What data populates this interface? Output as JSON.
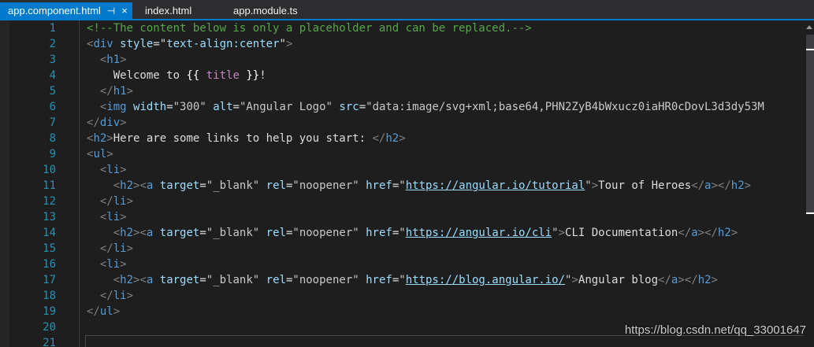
{
  "tabs": [
    {
      "label": "app.component.html",
      "active": true,
      "pin_icon": "pin-icon",
      "close_icon": "close-icon"
    },
    {
      "label": "index.html",
      "active": false
    },
    {
      "label": "app.module.ts",
      "active": false
    }
  ],
  "editor": {
    "line_numbers": [
      "1",
      "2",
      "3",
      "4",
      "5",
      "6",
      "7",
      "8",
      "9",
      "10",
      "11",
      "12",
      "13",
      "14",
      "15",
      "16",
      "17",
      "18",
      "19",
      "20",
      "21"
    ],
    "lines": {
      "l1": {
        "comment": "<!--The content below is only a placeholder and can be replaced.-->"
      },
      "l2": {
        "open": "<",
        "tag": "div",
        "sp": " ",
        "attr": "style",
        "eq": "=",
        "q1": "\"",
        "val": "text-align:center",
        "q2": "\"",
        "close": ">"
      },
      "l3": {
        "indent": "  ",
        "open": "<",
        "tag": "h1",
        "close": ">"
      },
      "l4": {
        "indent": "    ",
        "text1": "Welcome to ",
        "brace1": "{{",
        "sp1": " ",
        "binding": "title",
        "sp2": " ",
        "brace2": "}}",
        "text2": "!"
      },
      "l5": {
        "indent": "  ",
        "open": "</",
        "tag": "h1",
        "close": ">"
      },
      "l6": {
        "indent": "  ",
        "open": "<",
        "tag": "img",
        "sp1": " ",
        "attr1": "width",
        "eq1": "=",
        "v1": "\"300\"",
        "sp2": " ",
        "attr2": "alt",
        "eq2": "=",
        "v2": "\"Angular Logo\"",
        "sp3": " ",
        "attr3": "src",
        "eq3": "=",
        "v3": "\"data:image/svg+xml;base64,PHN2ZyB4bWxucz0iaHR0cDovL3d3dy53M"
      },
      "l7": {
        "open": "</",
        "tag": "div",
        "close": ">"
      },
      "l8": {
        "open": "<",
        "tag": "h2",
        "close": ">",
        "text": "Here are some links to help you start: ",
        "open2": "</",
        "tag2": "h2",
        "close2": ">"
      },
      "l9": {
        "open": "<",
        "tag": "ul",
        "close": ">"
      },
      "l10": {
        "indent": "  ",
        "open": "<",
        "tag": "li",
        "close": ">"
      },
      "l11": {
        "indent": "    ",
        "open1": "<",
        "tag1": "h2",
        "close1": ">",
        "open2": "<",
        "tag2": "a",
        "sp1": " ",
        "attr1": "target",
        "eq1": "=",
        "v1": "\"_blank\"",
        "sp2": " ",
        "attr2": "rel",
        "eq2": "=",
        "v2": "\"noopener\"",
        "sp3": " ",
        "attr3": "href",
        "eq3": "=",
        "q1": "\"",
        "url": "https://angular.io/tutorial",
        "q2": "\"",
        "close2": ">",
        "text": "Tour of Heroes",
        "open3": "</",
        "tag3": "a",
        "close3": ">",
        "open4": "</",
        "tag4": "h2",
        "close4": ">"
      },
      "l12": {
        "indent": "  ",
        "open": "</",
        "tag": "li",
        "close": ">"
      },
      "l13": {
        "indent": "  ",
        "open": "<",
        "tag": "li",
        "close": ">"
      },
      "l14": {
        "indent": "    ",
        "open1": "<",
        "tag1": "h2",
        "close1": ">",
        "open2": "<",
        "tag2": "a",
        "sp1": " ",
        "attr1": "target",
        "eq1": "=",
        "v1": "\"_blank\"",
        "sp2": " ",
        "attr2": "rel",
        "eq2": "=",
        "v2": "\"noopener\"",
        "sp3": " ",
        "attr3": "href",
        "eq3": "=",
        "q1": "\"",
        "url": "https://angular.io/cli",
        "q2": "\"",
        "close2": ">",
        "text": "CLI Documentation",
        "open3": "</",
        "tag3": "a",
        "close3": ">",
        "open4": "</",
        "tag4": "h2",
        "close4": ">"
      },
      "l15": {
        "indent": "  ",
        "open": "</",
        "tag": "li",
        "close": ">"
      },
      "l16": {
        "indent": "  ",
        "open": "<",
        "tag": "li",
        "close": ">"
      },
      "l17": {
        "indent": "    ",
        "open1": "<",
        "tag1": "h2",
        "close1": ">",
        "open2": "<",
        "tag2": "a",
        "sp1": " ",
        "attr1": "target",
        "eq1": "=",
        "v1": "\"_blank\"",
        "sp2": " ",
        "attr2": "rel",
        "eq2": "=",
        "v2": "\"noopener\"",
        "sp3": " ",
        "attr3": "href",
        "eq3": "=",
        "q1": "\"",
        "url": "https://blog.angular.io/",
        "q2": "\"",
        "close2": ">",
        "text": "Angular blog",
        "open3": "</",
        "tag3": "a",
        "close3": ">",
        "open4": "</",
        "tag4": "h2",
        "close4": ">"
      },
      "l18": {
        "indent": "  ",
        "open": "</",
        "tag": "li",
        "close": ">"
      },
      "l19": {
        "open": "</",
        "tag": "ul",
        "close": ">"
      }
    }
  },
  "watermark": "https://blog.csdn.net/qq_33001647",
  "colors": {
    "tab_active": "#007acc",
    "editor_bg": "#1e1e1e",
    "line_number": "#2b91af",
    "comment": "#57a64a",
    "tag": "#569cd6",
    "attribute": "#9cdcfe",
    "binding": "#c586c0"
  }
}
